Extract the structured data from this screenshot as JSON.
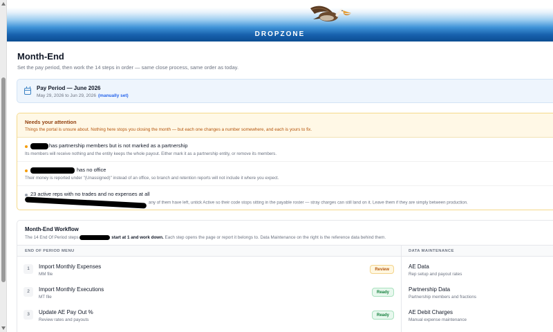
{
  "brand": {
    "name": "DROPZONE",
    "logo": "pelican-logo-icon"
  },
  "page": {
    "title": "Month-End",
    "subtitle": "Set the pay period, then work the 14 steps in order — same close process, same order as today."
  },
  "pay_period": {
    "icon": "calendar-icon",
    "title": "Pay Period — June 2026",
    "dates": "May 29, 2026 to Jun 29, 2026",
    "manual_label": "(manually set)"
  },
  "attention": {
    "title": "Needs your attention",
    "description": "Things the portal is unsure about. Nothing here stops you closing the month — but each one changes a number somewhere, and each is yours to fix.",
    "items": [
      {
        "headline": "has partnership members but is not marked as a partnership",
        "detail": "Its members will receive nothing and the entity keeps the whole payout. Either mark it as a partnership entity, or remove its members.",
        "dot_color": "#f59e0b"
      },
      {
        "headline": "has no office",
        "detail": "Their money is reported under \"(Unassigned)\" instead of an office, so branch and retention reports will not include it where you expect.",
        "dot_color": "#f59e0b"
      },
      {
        "headline": "23 active reps with no trades and no expenses at all",
        "detail": "any of them have left, untick Active so their code stops sitting in the payable roster — stray charges can still land on it. Leave them if they are simply between production.",
        "dot_color": "#9ca3af"
      }
    ]
  },
  "workflow": {
    "title": "Month-End Workflow",
    "desc_prefix": "The 14 End Of Period steps",
    "desc_bold": "start at 1 and work down.",
    "desc_suffix": "Each step opens the page or report it belongs to. Data Maintenance on the right is the reference data behind them.",
    "left_header": "END OF PERIOD MENU",
    "right_header": "DATA MAINTENANCE",
    "steps": [
      {
        "num": "1",
        "label": "Import Monthly Expenses",
        "sub": "MM file",
        "status": "Review"
      },
      {
        "num": "2",
        "label": "Import Monthly Executions",
        "sub": "MT file",
        "status": "Ready"
      },
      {
        "num": "3",
        "label": "Update AE Pay Out %",
        "sub": "Review rates and payouts",
        "status": "Ready"
      }
    ],
    "maintenance": [
      {
        "label": "AE Data",
        "sub": "Rep setup and payout rates"
      },
      {
        "label": "Partnership Data",
        "sub": "Partnership members and fractions"
      },
      {
        "label": "AE Debit Charges",
        "sub": "Manual expense maintenance"
      }
    ]
  }
}
